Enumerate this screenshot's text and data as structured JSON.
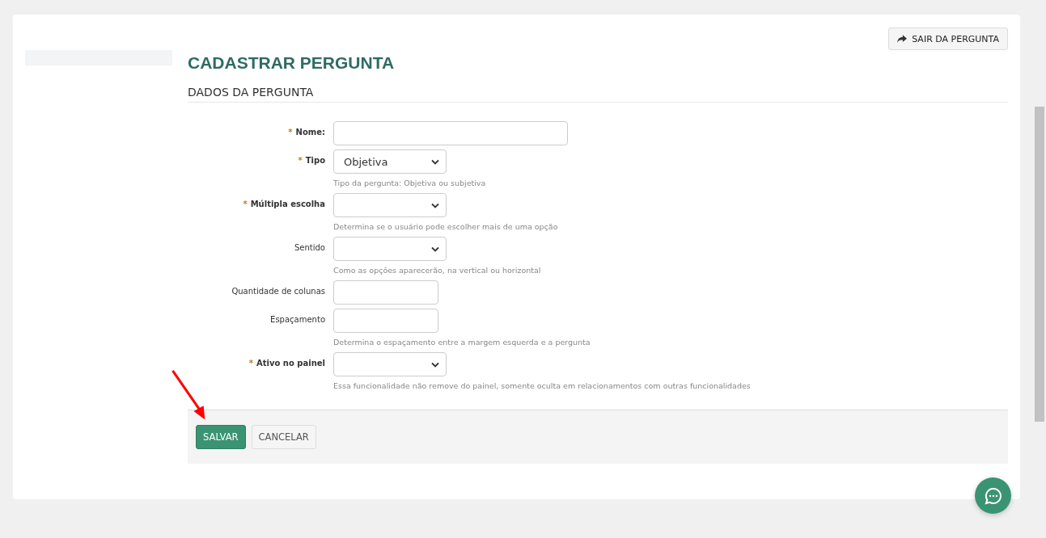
{
  "header": {
    "exit_button": "SAIR DA PERGUNTA",
    "title": "CADASTRAR PERGUNTA",
    "section": "DADOS DA PERGUNTA"
  },
  "fields": [
    {
      "marker": "*",
      "label": "Nome:",
      "kind": "longtext"
    },
    {
      "marker": "*",
      "label": "Tipo",
      "kind": "select",
      "value": "Objetiva",
      "help": "Tipo da pergunta: Objetiva ou subjetiva"
    },
    {
      "marker": "*",
      "label": "Múltipla escolha",
      "kind": "select",
      "help": "Determina se o usuário pode escolher mais de uma opção"
    },
    {
      "label": "Sentido",
      "kind": "select",
      "help": "Como as opções aparecerão, na vertical ou horizontal"
    },
    {
      "label": "Quantidade de colunas",
      "kind": "text"
    },
    {
      "label": "Espaçamento",
      "kind": "text",
      "help": "Determina o espaçamento entre a margem esquerda e a pergunta"
    },
    {
      "marker": "*",
      "label": "Ativo no painel",
      "kind": "select",
      "help": "Essa funcionalidade não remove do painel, somente oculta em relacionamentos com outras funcionalidades"
    }
  ],
  "actions": {
    "save": "SALVAR",
    "cancel": "CANCELAR"
  }
}
